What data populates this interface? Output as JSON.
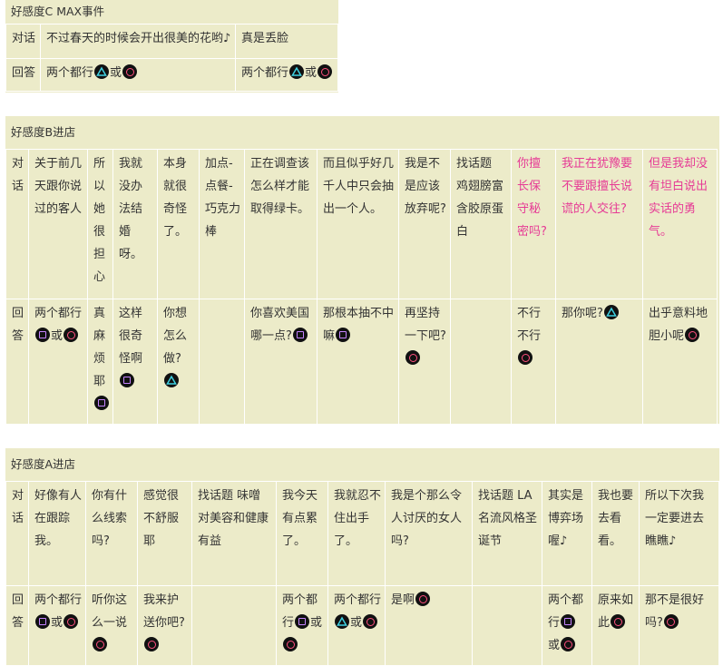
{
  "icons": {
    "square": "square-button-icon",
    "circle": "circle-button-icon",
    "triangle": "triangle-button-icon"
  },
  "colors": {
    "background": "#ecebc9",
    "highlight_text": "#e63a95",
    "square": "#c583ff",
    "circle": "#ff4f7e",
    "triangle": "#3fd0e0"
  },
  "sections": [
    {
      "id": "cmax",
      "title": "好感度C MAX事件",
      "rows": [
        {
          "label": "对话",
          "cells": [
            {
              "text": "不过春天的时候会开出很美的花哟♪"
            },
            {
              "text": "真是丢脸"
            }
          ]
        },
        {
          "label": "回答",
          "cells": [
            {
              "parts": [
                {
                  "t": "两个都行"
                },
                {
                  "i": "triangle"
                },
                {
                  "t": "或"
                },
                {
                  "i": "circle"
                }
              ]
            },
            {
              "parts": [
                {
                  "t": "两个都行"
                },
                {
                  "i": "triangle"
                },
                {
                  "t": "或"
                },
                {
                  "i": "circle"
                }
              ]
            }
          ]
        }
      ]
    },
    {
      "id": "b",
      "title": "好感度B进店",
      "rows": [
        {
          "label": "对话",
          "cells": [
            {
              "text": "关于前几天跟你说过的客人"
            },
            {
              "text": "所以她很担心"
            },
            {
              "text": "我就没办法结婚呀。"
            },
            {
              "text": "本身就很奇怪了。"
            },
            {
              "text": "加点-点餐-巧克力棒"
            },
            {
              "text": "正在调查该怎么样才能取得绿卡。"
            },
            {
              "text": "而且似乎好几千人中只会抽出一个人。"
            },
            {
              "text": "我是不是应该放弃呢?"
            },
            {
              "text": "找话题 鸡翅膀富含胶原蛋白"
            },
            {
              "text": "你擅长保守秘密吗?",
              "pink": true
            },
            {
              "text": "我正在犹豫要不要跟擅长说谎的人交往?",
              "pink": true
            },
            {
              "text": "但是我却没有坦白说出实话的勇气。",
              "pink": true
            }
          ]
        },
        {
          "label": "回答",
          "cells": [
            {
              "parts": [
                {
                  "t": "两个都行"
                },
                {
                  "i": "square"
                },
                {
                  "t": "或"
                },
                {
                  "i": "circle"
                }
              ]
            },
            {
              "parts": [
                {
                  "t": "真麻烦耶"
                },
                {
                  "i": "square"
                }
              ]
            },
            {
              "parts": [
                {
                  "t": "这样很奇怪啊"
                },
                {
                  "i": "square"
                }
              ]
            },
            {
              "parts": [
                {
                  "t": "你想怎么做?"
                },
                {
                  "i": "triangle"
                }
              ]
            },
            {
              "parts": []
            },
            {
              "parts": [
                {
                  "t": "你喜欢美国哪一点?"
                },
                {
                  "i": "square"
                }
              ]
            },
            {
              "parts": [
                {
                  "t": "那根本抽不中嘛"
                },
                {
                  "i": "square"
                }
              ]
            },
            {
              "parts": [
                {
                  "t": "再坚持一下吧?"
                },
                {
                  "i": "circle"
                }
              ]
            },
            {
              "parts": []
            },
            {
              "parts": [
                {
                  "t": "不行不行"
                },
                {
                  "i": "circle"
                }
              ]
            },
            {
              "parts": [
                {
                  "t": "那你呢?"
                },
                {
                  "i": "triangle"
                }
              ]
            },
            {
              "parts": [
                {
                  "t": "出乎意料地胆小呢"
                },
                {
                  "i": "circle"
                }
              ]
            }
          ]
        }
      ]
    },
    {
      "id": "a",
      "title": "好感度A进店",
      "rows": [
        {
          "label": "对话",
          "cells": [
            {
              "text": "好像有人在跟踪我。"
            },
            {
              "text": "你有什么线索吗?"
            },
            {
              "text": "感觉很不舒服耶"
            },
            {
              "text": "找话题 味噌对美容和健康有益"
            },
            {
              "text": "我今天有点累了。"
            },
            {
              "text": "我就忍不住出手了。"
            },
            {
              "text": "我是个那么令人讨厌的女人吗?"
            },
            {
              "text": "找话题 LA名流风格圣诞节"
            },
            {
              "text": "其实是博弈场喔♪"
            },
            {
              "text": "我也要去看看。"
            },
            {
              "text": "所以下次我一定要进去瞧瞧♪"
            }
          ]
        },
        {
          "label": "回答",
          "cells": [
            {
              "parts": [
                {
                  "t": "两个都行"
                },
                {
                  "i": "square"
                },
                {
                  "t": "或"
                },
                {
                  "i": "circle"
                }
              ]
            },
            {
              "parts": [
                {
                  "t": "听你这么一说"
                },
                {
                  "i": "circle"
                }
              ]
            },
            {
              "parts": [
                {
                  "t": "我来护送你吧?"
                },
                {
                  "i": "circle"
                }
              ]
            },
            {
              "parts": []
            },
            {
              "parts": [
                {
                  "t": "两个都行"
                },
                {
                  "i": "square"
                },
                {
                  "t": "或"
                },
                {
                  "i": "circle"
                }
              ]
            },
            {
              "parts": [
                {
                  "t": "两个都行"
                },
                {
                  "i": "triangle"
                },
                {
                  "t": "或"
                },
                {
                  "i": "circle"
                }
              ]
            },
            {
              "parts": [
                {
                  "t": "是啊"
                },
                {
                  "i": "circle"
                }
              ]
            },
            {
              "parts": []
            },
            {
              "parts": [
                {
                  "t": "两个都行"
                },
                {
                  "i": "square"
                },
                {
                  "t": "或"
                },
                {
                  "i": "circle"
                }
              ]
            },
            {
              "parts": [
                {
                  "t": "原来如此"
                },
                {
                  "i": "circle"
                }
              ]
            },
            {
              "parts": [
                {
                  "t": "那不是很好吗?"
                },
                {
                  "i": "circle"
                }
              ]
            }
          ]
        }
      ]
    }
  ]
}
